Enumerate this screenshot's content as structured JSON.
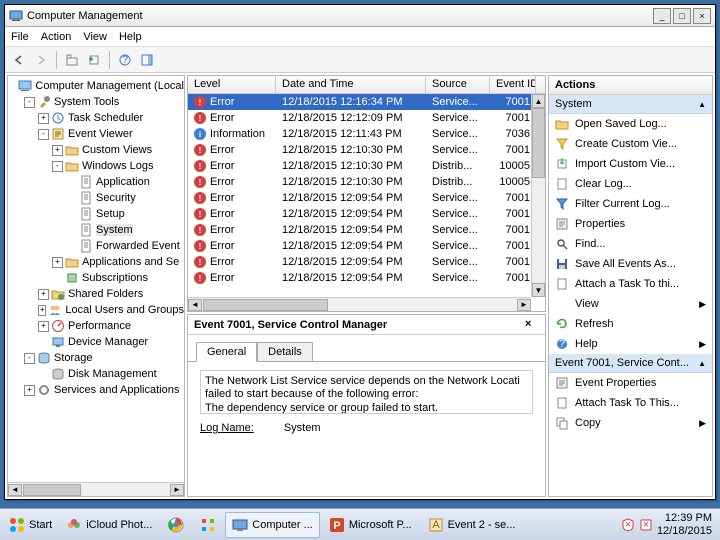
{
  "window": {
    "title": "Computer Management",
    "menubar": [
      "File",
      "Action",
      "View",
      "Help"
    ]
  },
  "tree": [
    {
      "lvl": 0,
      "exp": "",
      "icon": "computer",
      "label": "Computer Management (Local"
    },
    {
      "lvl": 1,
      "exp": "-",
      "icon": "tools",
      "label": "System Tools"
    },
    {
      "lvl": 2,
      "exp": "+",
      "icon": "sched",
      "label": "Task Scheduler"
    },
    {
      "lvl": 2,
      "exp": "-",
      "icon": "event",
      "label": "Event Viewer"
    },
    {
      "lvl": 3,
      "exp": "+",
      "icon": "folder",
      "label": "Custom Views"
    },
    {
      "lvl": 3,
      "exp": "-",
      "icon": "folder",
      "label": "Windows Logs"
    },
    {
      "lvl": 4,
      "exp": "",
      "icon": "log",
      "label": "Application"
    },
    {
      "lvl": 4,
      "exp": "",
      "icon": "log",
      "label": "Security"
    },
    {
      "lvl": 4,
      "exp": "",
      "icon": "log",
      "label": "Setup"
    },
    {
      "lvl": 4,
      "exp": "",
      "icon": "log",
      "label": "System",
      "sel": true
    },
    {
      "lvl": 4,
      "exp": "",
      "icon": "log",
      "label": "Forwarded Event"
    },
    {
      "lvl": 3,
      "exp": "+",
      "icon": "folder",
      "label": "Applications and Se"
    },
    {
      "lvl": 3,
      "exp": "",
      "icon": "sub",
      "label": "Subscriptions"
    },
    {
      "lvl": 2,
      "exp": "+",
      "icon": "shared",
      "label": "Shared Folders"
    },
    {
      "lvl": 2,
      "exp": "+",
      "icon": "users",
      "label": "Local Users and Groups"
    },
    {
      "lvl": 2,
      "exp": "+",
      "icon": "perf",
      "label": "Performance"
    },
    {
      "lvl": 2,
      "exp": "",
      "icon": "device",
      "label": "Device Manager"
    },
    {
      "lvl": 1,
      "exp": "-",
      "icon": "storage",
      "label": "Storage"
    },
    {
      "lvl": 2,
      "exp": "",
      "icon": "disk",
      "label": "Disk Management"
    },
    {
      "lvl": 1,
      "exp": "+",
      "icon": "services",
      "label": "Services and Applications"
    }
  ],
  "events": {
    "columns": [
      "Level",
      "Date and Time",
      "Source",
      "Event ID"
    ],
    "rows": [
      {
        "level": "Error",
        "icon": "err",
        "date": "12/18/2015 12:16:34 PM",
        "src": "Service...",
        "id": "7001",
        "sel": true
      },
      {
        "level": "Error",
        "icon": "err",
        "date": "12/18/2015 12:12:09 PM",
        "src": "Service...",
        "id": "7001"
      },
      {
        "level": "Information",
        "icon": "info",
        "date": "12/18/2015 12:11:43 PM",
        "src": "Service...",
        "id": "7036"
      },
      {
        "level": "Error",
        "icon": "err",
        "date": "12/18/2015 12:10:30 PM",
        "src": "Service...",
        "id": "7001"
      },
      {
        "level": "Error",
        "icon": "err",
        "date": "12/18/2015 12:10:30 PM",
        "src": "Distrib...",
        "id": "10005"
      },
      {
        "level": "Error",
        "icon": "err",
        "date": "12/18/2015 12:10:30 PM",
        "src": "Distrib...",
        "id": "10005"
      },
      {
        "level": "Error",
        "icon": "err",
        "date": "12/18/2015 12:09:54 PM",
        "src": "Service...",
        "id": "7001"
      },
      {
        "level": "Error",
        "icon": "err",
        "date": "12/18/2015 12:09:54 PM",
        "src": "Service...",
        "id": "7001"
      },
      {
        "level": "Error",
        "icon": "err",
        "date": "12/18/2015 12:09:54 PM",
        "src": "Service...",
        "id": "7001"
      },
      {
        "level": "Error",
        "icon": "err",
        "date": "12/18/2015 12:09:54 PM",
        "src": "Service...",
        "id": "7001"
      },
      {
        "level": "Error",
        "icon": "err",
        "date": "12/18/2015 12:09:54 PM",
        "src": "Service...",
        "id": "7001"
      },
      {
        "level": "Error",
        "icon": "err",
        "date": "12/18/2015 12:09:54 PM",
        "src": "Service...",
        "id": "7001"
      }
    ]
  },
  "detail": {
    "title": "Event 7001, Service Control Manager",
    "tabs": [
      "General",
      "Details"
    ],
    "message": "The Network List Service service depends on the Network Locati\nfailed to start because of the following error:\nThe dependency service or group failed to start.",
    "logname_label": "Log Name:",
    "logname_value": "System"
  },
  "actions": {
    "header": "Actions",
    "groups": [
      {
        "title": "System",
        "items": [
          {
            "icon": "open",
            "label": "Open Saved Log..."
          },
          {
            "icon": "funnel-y",
            "label": "Create Custom Vie..."
          },
          {
            "icon": "import",
            "label": "Import Custom Vie..."
          },
          {
            "icon": "clear",
            "label": "Clear Log..."
          },
          {
            "icon": "funnel-b",
            "label": "Filter Current Log..."
          },
          {
            "icon": "prop",
            "label": "Properties"
          },
          {
            "icon": "find",
            "label": "Find..."
          },
          {
            "icon": "save",
            "label": "Save All Events As..."
          },
          {
            "icon": "task",
            "label": "Attach a Task To thi..."
          },
          {
            "icon": "view",
            "label": "View",
            "sub": true
          },
          {
            "icon": "refresh",
            "label": "Refresh"
          },
          {
            "icon": "help",
            "label": "Help",
            "sub": true
          }
        ]
      },
      {
        "title": "Event 7001, Service Cont...",
        "items": [
          {
            "icon": "prop",
            "label": "Event Properties"
          },
          {
            "icon": "task",
            "label": "Attach Task To This..."
          },
          {
            "icon": "copy",
            "label": "Copy",
            "sub": true
          }
        ]
      }
    ]
  },
  "taskbar": {
    "start": "Start",
    "items": [
      {
        "icon": "photos",
        "label": "iCloud Phot..."
      },
      {
        "icon": "chrome",
        "label": ""
      },
      {
        "icon": "apps",
        "label": ""
      },
      {
        "icon": "mmc",
        "label": "Computer ...",
        "active": true
      },
      {
        "icon": "ppt",
        "label": "Microsoft P..."
      },
      {
        "icon": "event2",
        "label": "Event 2 - se..."
      }
    ],
    "tray_time": "12:39 PM",
    "tray_date": "12/18/2015"
  }
}
